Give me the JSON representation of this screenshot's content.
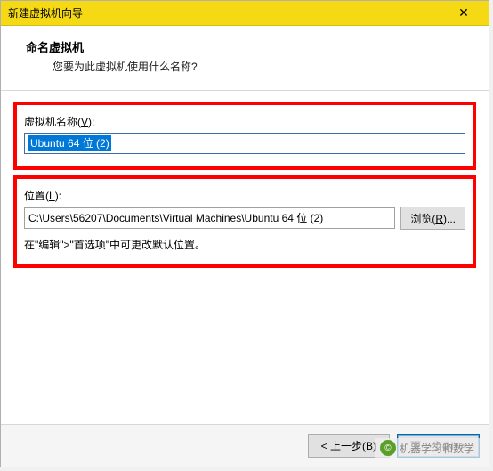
{
  "titlebar": {
    "title": "新建虚拟机向导",
    "close": "✕"
  },
  "header": {
    "title": "命名虚拟机",
    "subtitle": "您要为此虚拟机使用什么名称?"
  },
  "vmname": {
    "label_pre": "虚拟机名称(",
    "label_key": "V",
    "label_post": "):",
    "value": "Ubuntu 64 位 (2)"
  },
  "location": {
    "label_pre": "位置(",
    "label_key": "L",
    "label_post": "):",
    "value": "C:\\Users\\56207\\Documents\\Virtual Machines\\Ubuntu 64 位 (2)",
    "browse_pre": "浏览(",
    "browse_key": "R",
    "browse_post": ")...",
    "hint": "在\"编辑\">\"首选项\"中可更改默认位置。"
  },
  "footer": {
    "back_pre": "< 上一步(",
    "back_key": "B",
    "back_post": ")",
    "next_pre": "下一步(",
    "next_key": "N",
    "next_post": ") >"
  },
  "watermark": {
    "icon": "©",
    "text": "机器学习和数学"
  }
}
